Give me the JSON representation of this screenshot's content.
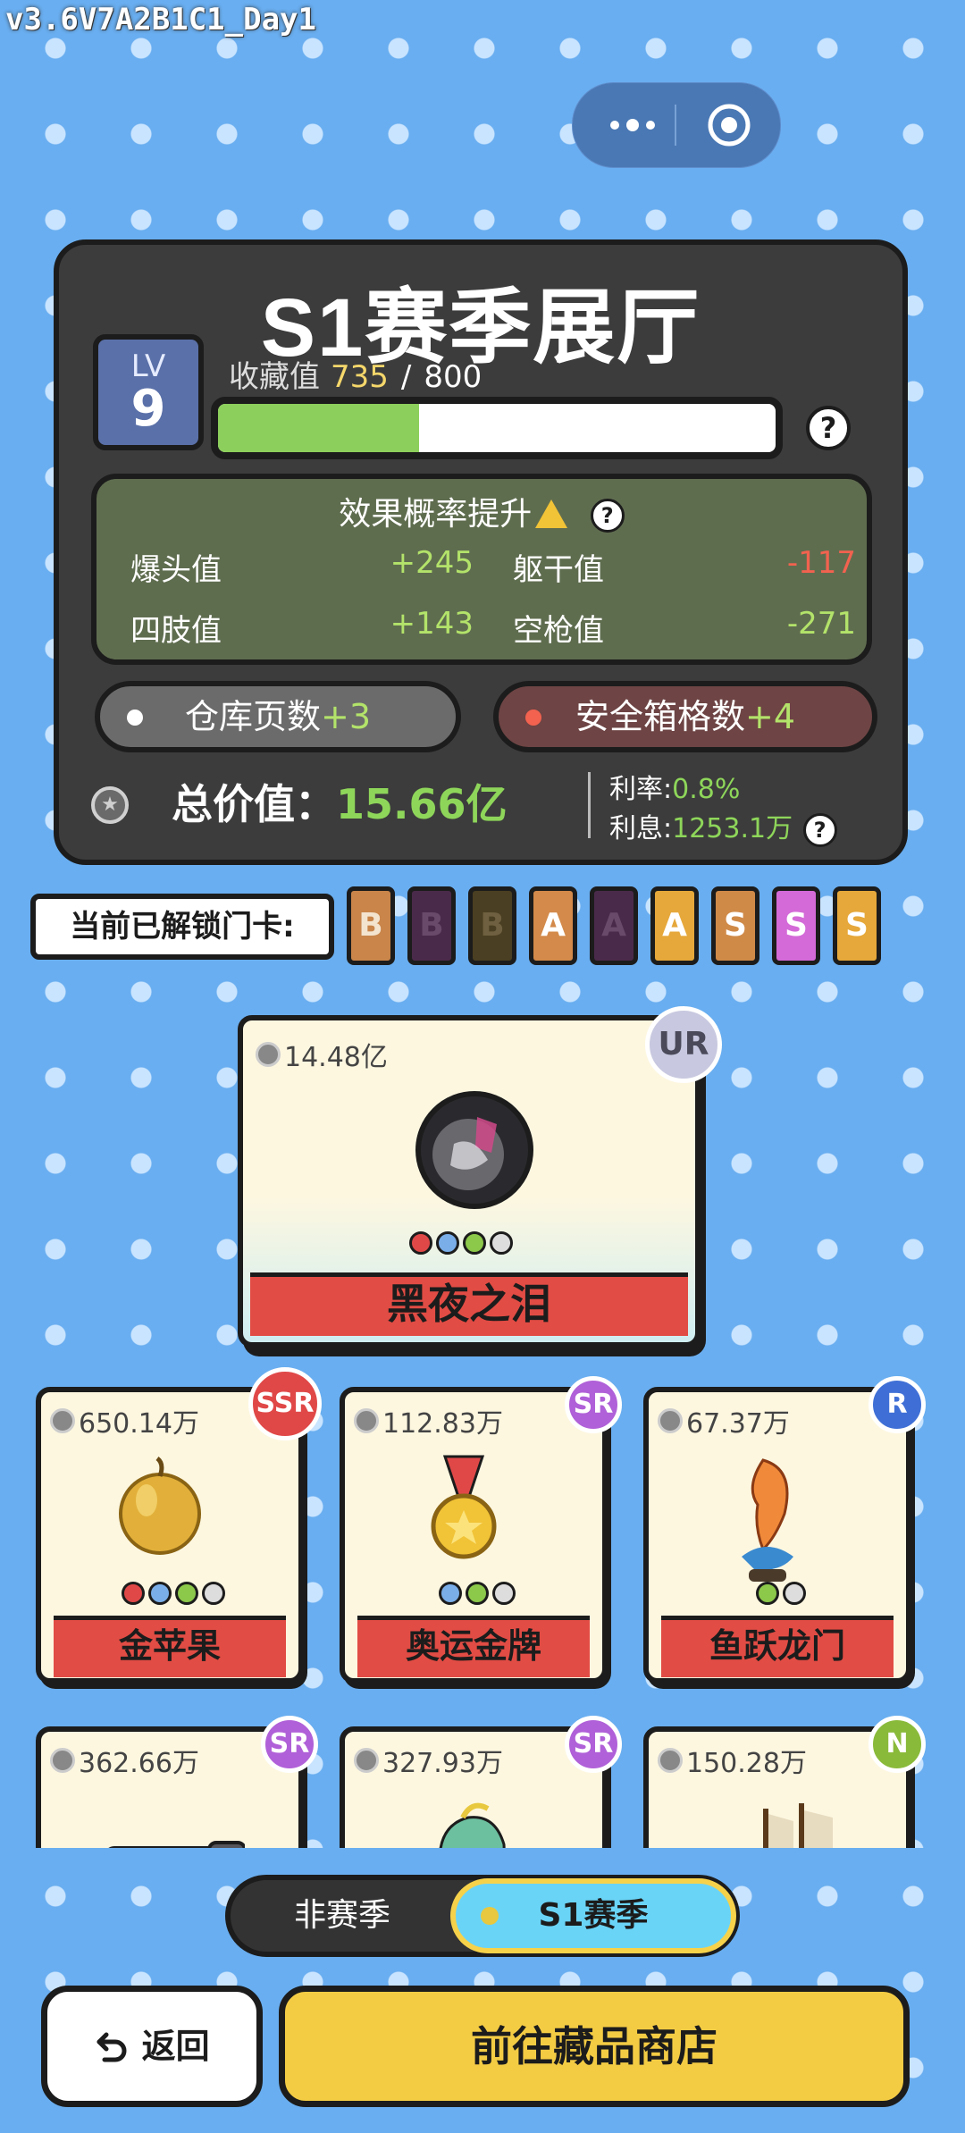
{
  "version": "v3.6V7A2B1C1_Day1",
  "hall": {
    "title": "S1赛季展厅",
    "lv_label": "LV",
    "level": "9",
    "collect_label": "收藏值",
    "collect_value": "735",
    "collect_sep": "/",
    "collect_max": "800",
    "progress_fraction": 0.36,
    "help": "?"
  },
  "effect": {
    "title": "效果概率提升",
    "help": "?",
    "stats": [
      {
        "label": "爆头值",
        "value": "+245"
      },
      {
        "label": "躯干值",
        "value": "-117"
      },
      {
        "label": "四肢值",
        "value": "+143"
      },
      {
        "label": "空枪值",
        "value": "-271"
      }
    ]
  },
  "pills": {
    "warehouse_label": "仓库页数",
    "warehouse_bonus": "+3",
    "safebox_label": "安全箱格数",
    "safebox_bonus": "+4"
  },
  "totals": {
    "total_label": "总价值：",
    "total_value": "15.66亿",
    "rate_label": "利率:",
    "rate_value": "0.8%",
    "interest_label": "利息:",
    "interest_value": "1253.1万",
    "help": "?"
  },
  "unlock": {
    "label": "当前已解锁门卡:",
    "cards": [
      {
        "letter": "B",
        "color": "#c9854a",
        "text": "#f3e4cf"
      },
      {
        "letter": "B",
        "color": "#4a2a4a",
        "text": "#6a4a6a"
      },
      {
        "letter": "B",
        "color": "#4a3f22",
        "text": "#6e6040"
      },
      {
        "letter": "A",
        "color": "#d38a4a",
        "text": "#ffffff"
      },
      {
        "letter": "A",
        "color": "#4a2a4a",
        "text": "#6a4a6a"
      },
      {
        "letter": "A",
        "color": "#e6a83a",
        "text": "#ffffff"
      },
      {
        "letter": "S",
        "color": "#d08a48",
        "text": "#ffffff"
      },
      {
        "letter": "S",
        "color": "#d46ad8",
        "text": "#ffffff"
      },
      {
        "letter": "S",
        "color": "#e6a83a",
        "text": "#ffffff"
      }
    ]
  },
  "featured": {
    "price": "14.48亿",
    "rarity": "UR",
    "name": "黑夜之泪",
    "symbols": [
      "pentagon-red",
      "diamond-blue",
      "triangle-green",
      "diamond-grey"
    ]
  },
  "items": [
    {
      "price": "650.14万",
      "rarity": "SSR",
      "rarity_color": "#e04848",
      "name": "金苹果",
      "icon": "golden-apple-icon"
    },
    {
      "price": "112.83万",
      "rarity": "SR",
      "rarity_color": "#b060d8",
      "name": "奥运金牌",
      "icon": "gold-medal-icon"
    },
    {
      "price": "67.37万",
      "rarity": "R",
      "rarity_color": "#3f6fd6",
      "name": "鱼跃龙门",
      "icon": "carp-statue-icon"
    },
    {
      "price": "362.66万",
      "rarity": "SR",
      "rarity_color": "#b060d8",
      "name": "",
      "icon": "telescope-icon"
    },
    {
      "price": "327.93万",
      "rarity": "SR",
      "rarity_color": "#b060d8",
      "name": "",
      "icon": "jade-horse-icon"
    },
    {
      "price": "150.28万",
      "rarity": "N",
      "rarity_color": "#8aba3a",
      "name": "",
      "icon": "sailing-ship-icon"
    }
  ],
  "tabs": {
    "off_season": "非赛季",
    "season": "S1赛季"
  },
  "buttons": {
    "back": "返回",
    "shop": "前往藏品商店"
  }
}
